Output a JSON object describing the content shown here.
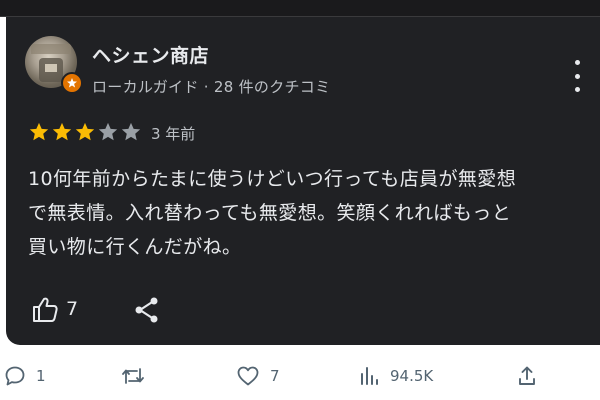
{
  "review": {
    "reviewer_name": "ヘシェン商店",
    "reviewer_meta": "ローカルガイド · 28 件のクチコミ",
    "rating": 3,
    "rating_max": 5,
    "date": "3 年前",
    "text_lines": [
      "10何年前からたまに使うけどいつ行っても店員が無愛想",
      "で無表情。入れ替わっても無愛想。笑顔くれればもっと",
      "買い物に行くんだがね。"
    ],
    "likes": "7",
    "icons": {
      "more": "more-vert-icon",
      "badge": "local-guide-badge-icon",
      "like": "thumbs-up-icon",
      "share": "share-icon"
    },
    "colors": {
      "card_bg": "#202124",
      "star_filled": "#fbbc04",
      "star_empty": "#9aa0a6",
      "badge": "#e37400"
    }
  },
  "post_actions": {
    "replies": "1",
    "reposts": "",
    "likes": "7",
    "views": "94.5K",
    "icons": {
      "reply": "reply-icon",
      "repost": "repost-icon",
      "like": "heart-icon",
      "views": "views-chart-icon",
      "share": "share-upload-icon"
    },
    "colors": {
      "icon": "#536471"
    }
  }
}
